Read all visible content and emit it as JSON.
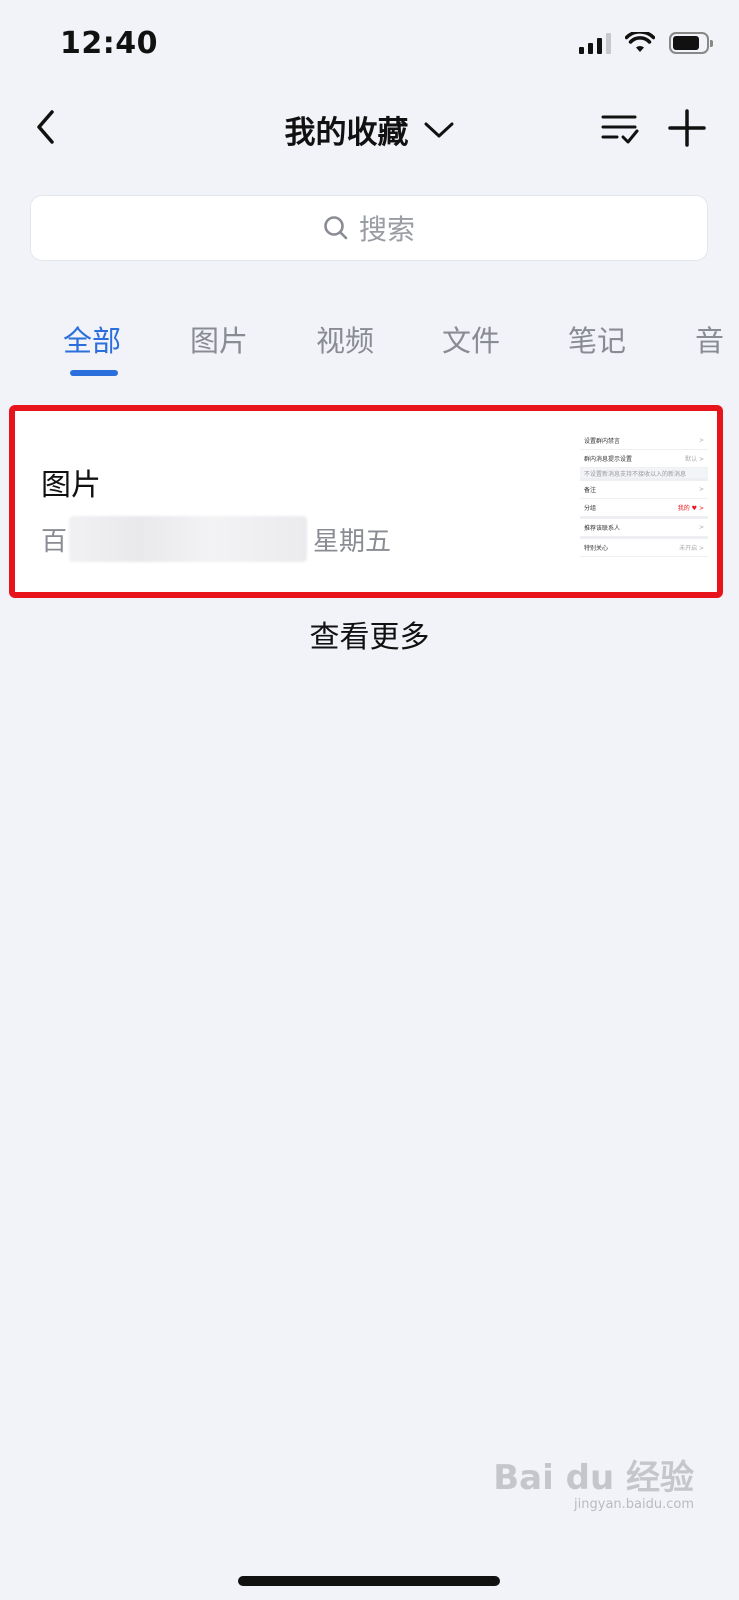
{
  "status_bar": {
    "time": "12:40"
  },
  "header": {
    "title": "我的收藏"
  },
  "search": {
    "placeholder": "搜索"
  },
  "tabs": [
    {
      "label": "全部",
      "active": true
    },
    {
      "label": "图片",
      "active": false
    },
    {
      "label": "视频",
      "active": false
    },
    {
      "label": "文件",
      "active": false
    },
    {
      "label": "笔记",
      "active": false
    },
    {
      "label": "音",
      "active": false
    }
  ],
  "items": [
    {
      "title": "图片",
      "source_prefix": "百",
      "day": "星期五",
      "thumbnail_rows": [
        {
          "label": "设置群内禁言",
          "value": ">"
        },
        {
          "label": "群内消息提示设置",
          "value": "默认 >"
        },
        {
          "label": "不设置新消息支持不接收以入的新消息",
          "value": ""
        },
        {
          "label": "备注",
          "value": ">"
        },
        {
          "label": "分组",
          "value": "我的 ♥ >"
        },
        {
          "label": "推荐该联系人",
          "value": ">"
        },
        {
          "label": "特别关心",
          "value": "未开启 >"
        }
      ]
    }
  ],
  "more_label": "查看更多",
  "watermark": {
    "brand": "Bai du 经验",
    "url": "jingyan.baidu.com"
  },
  "colors": {
    "accent": "#2a6fdb",
    "highlight": "#e8141b",
    "background": "#f2f3f8"
  }
}
